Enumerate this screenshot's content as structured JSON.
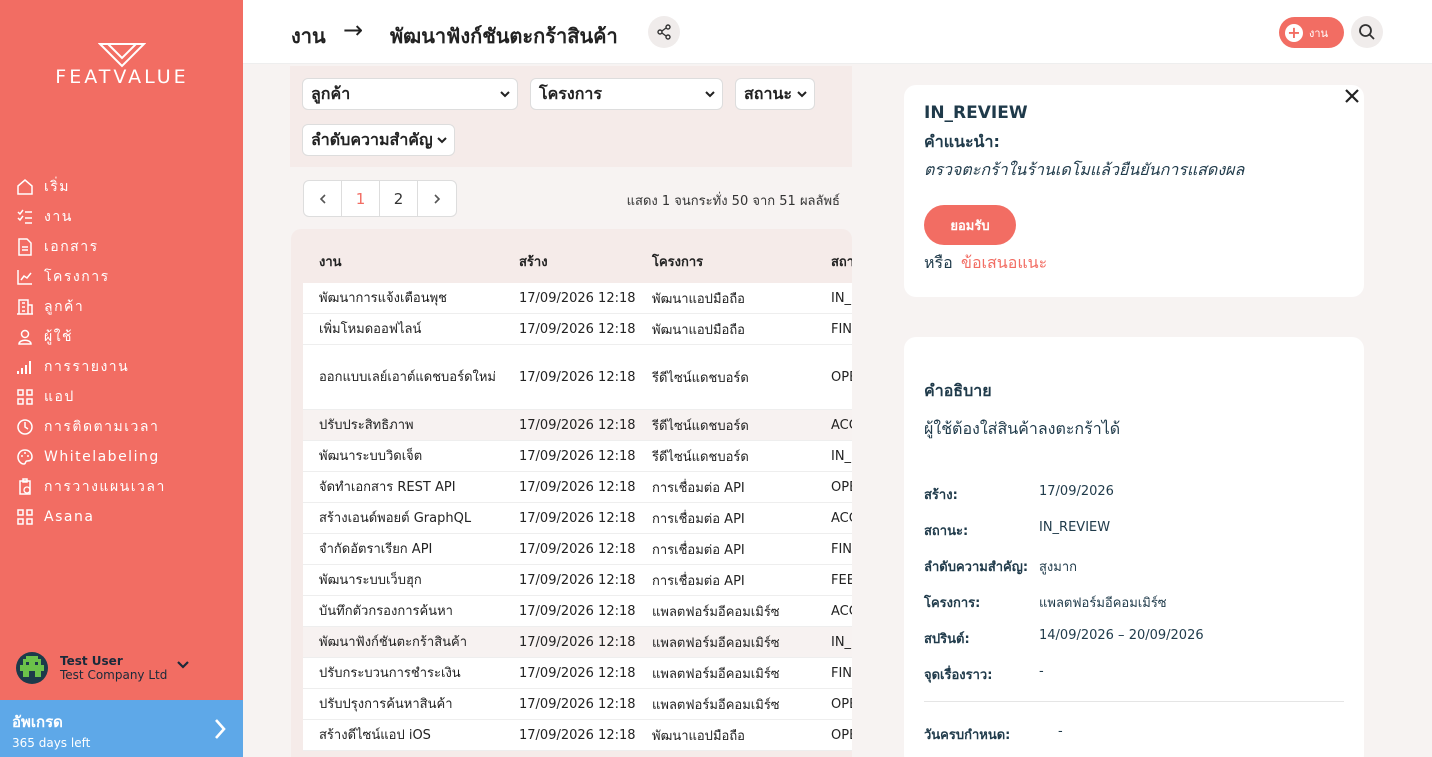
{
  "brand": {
    "name": "FEATVALUE",
    "accent": "#f26d63",
    "upgrade_color": "#5ea8e8"
  },
  "sidebar": {
    "items": [
      {
        "label": "เริ่ม",
        "icon": "home-icon"
      },
      {
        "label": "งาน",
        "icon": "task-list-icon"
      },
      {
        "label": "เอกสาร",
        "icon": "document-icon"
      },
      {
        "label": "โครงการ",
        "icon": "chart-icon"
      },
      {
        "label": "ลูกค้า",
        "icon": "building-icon"
      },
      {
        "label": "ผู้ใช้",
        "icon": "user-icon"
      },
      {
        "label": "การรายงาน",
        "icon": "bar-chart-icon"
      },
      {
        "label": "แอป",
        "icon": "apps-icon"
      },
      {
        "label": "การติดตามเวลา",
        "icon": "clock-icon"
      },
      {
        "label": "Whitelabeling",
        "icon": "palette-icon"
      },
      {
        "label": "การวางแผนเวลา",
        "icon": "clipboard-clock-icon"
      },
      {
        "label": "Asana",
        "icon": "apps-icon"
      }
    ],
    "user": {
      "name": "Test User",
      "company": "Test Company Ltd"
    },
    "upgrade": {
      "title": "อัพเกรด",
      "subtitle": "365 days left"
    }
  },
  "header": {
    "crumb1": "งาน",
    "crumb_arrow": "→",
    "crumb2": "พัฒนาฟังก์ชันตะกร้าสินค้า",
    "add_label": "งาน"
  },
  "filters": {
    "customer": "ลูกค้า",
    "project": "โครงการ",
    "status": "สถานะ",
    "priority": "ลำดับความสำคัญ"
  },
  "pagination": {
    "pages": [
      "1",
      "2"
    ],
    "showing": "แสดง 1 จนกระทั่ง 50 จาก 51 ผลลัพธ์"
  },
  "table": {
    "headers": [
      "งาน",
      "สร้าง",
      "โครงการ",
      "สถานะ"
    ],
    "rows": [
      {
        "task": "พัฒนาการแจ้งเตือนพุช",
        "created": "17/09/2026 12:18",
        "project": "พัฒนาแอปมือถือ",
        "status": "IN_PROGRESS"
      },
      {
        "task": "เพิ่มโหมดออฟไลน์",
        "created": "17/09/2026 12:18",
        "project": "พัฒนาแอปมือถือ",
        "status": "FINISHED"
      },
      {
        "task": "ออกแบบเลย์เอาต์แดชบอร์ดใหม่",
        "created": "17/09/2026 12:18",
        "project": "รีดีไซน์แดชบอร์ด",
        "status": "OPEN"
      },
      {
        "task": "ปรับประสิทธิภาพ",
        "created": "17/09/2026 12:18",
        "project": "รีดีไซน์แดชบอร์ด",
        "status": "ACCEPTED"
      },
      {
        "task": "พัฒนาระบบวิดเจ็ต",
        "created": "17/09/2026 12:18",
        "project": "รีดีไซน์แดชบอร์ด",
        "status": "IN_PROGRESS"
      },
      {
        "task": "จัดทำเอกสาร REST API",
        "created": "17/09/2026 12:18",
        "project": "การเชื่อมต่อ API",
        "status": "OPEN"
      },
      {
        "task": "สร้างเอนด์พอยต์ GraphQL",
        "created": "17/09/2026 12:18",
        "project": "การเชื่อมต่อ API",
        "status": "ACCEPTED"
      },
      {
        "task": "จำกัดอัตราเรียก API",
        "created": "17/09/2026 12:18",
        "project": "การเชื่อมต่อ API",
        "status": "FINISHED"
      },
      {
        "task": "พัฒนาระบบเว็บฮุก",
        "created": "17/09/2026 12:18",
        "project": "การเชื่อมต่อ API",
        "status": "FEEDBACK"
      },
      {
        "task": "บันทึกตัวกรองการค้นหา",
        "created": "17/09/2026 12:18",
        "project": "แพลตฟอร์มอีคอมเมิร์ซ",
        "status": "ACCEPTED"
      },
      {
        "task": "พัฒนาฟังก์ชันตะกร้าสินค้า",
        "created": "17/09/2026 12:18",
        "project": "แพลตฟอร์มอีคอมเมิร์ซ",
        "status": "IN_REVIEW"
      },
      {
        "task": "ปรับกระบวนการชำระเงิน",
        "created": "17/09/2026 12:18",
        "project": "แพลตฟอร์มอีคอมเมิร์ซ",
        "status": "FINISHED"
      },
      {
        "task": "ปรับปรุงการค้นหาสินค้า",
        "created": "17/09/2026 12:18",
        "project": "แพลตฟอร์มอีคอมเมิร์ซ",
        "status": "OPEN"
      },
      {
        "task": "สร้างดีไซน์แอป iOS",
        "created": "17/09/2026 12:18",
        "project": "พัฒนาแอปมือถือ",
        "status": "OPEN"
      }
    ]
  },
  "review": {
    "status": "IN_REVIEW",
    "rec_label": "คำแนะนำ:",
    "rec_text": "ตรวจตะกร้าในร้านเดโมแล้วยืนยันการแสดงผล",
    "accept": "ยอมรับ",
    "or": "หรือ",
    "suggest": "ข้อเสนอแนะ"
  },
  "details": {
    "desc_title": "คำอธิบาย",
    "desc_text": "ผู้ใช้ต้องใส่สินค้าลงตะกร้าได้",
    "fields": [
      {
        "label": "สร้าง:",
        "value": "17/09/2026"
      },
      {
        "label": "สถานะ:",
        "value": "IN_REVIEW"
      },
      {
        "label": "ลำดับความสำคัญ:",
        "value": "สูงมาก"
      },
      {
        "label": "โครงการ:",
        "value": "แพลตฟอร์มอีคอมเมิร์ซ"
      },
      {
        "label": "สปรินต์:",
        "value": "14/09/2026 – 20/09/2026"
      },
      {
        "label": "จุดเรื่องราว:",
        "value": "-"
      }
    ],
    "due_label": "วันครบกำหนด:",
    "due_value": "-"
  }
}
